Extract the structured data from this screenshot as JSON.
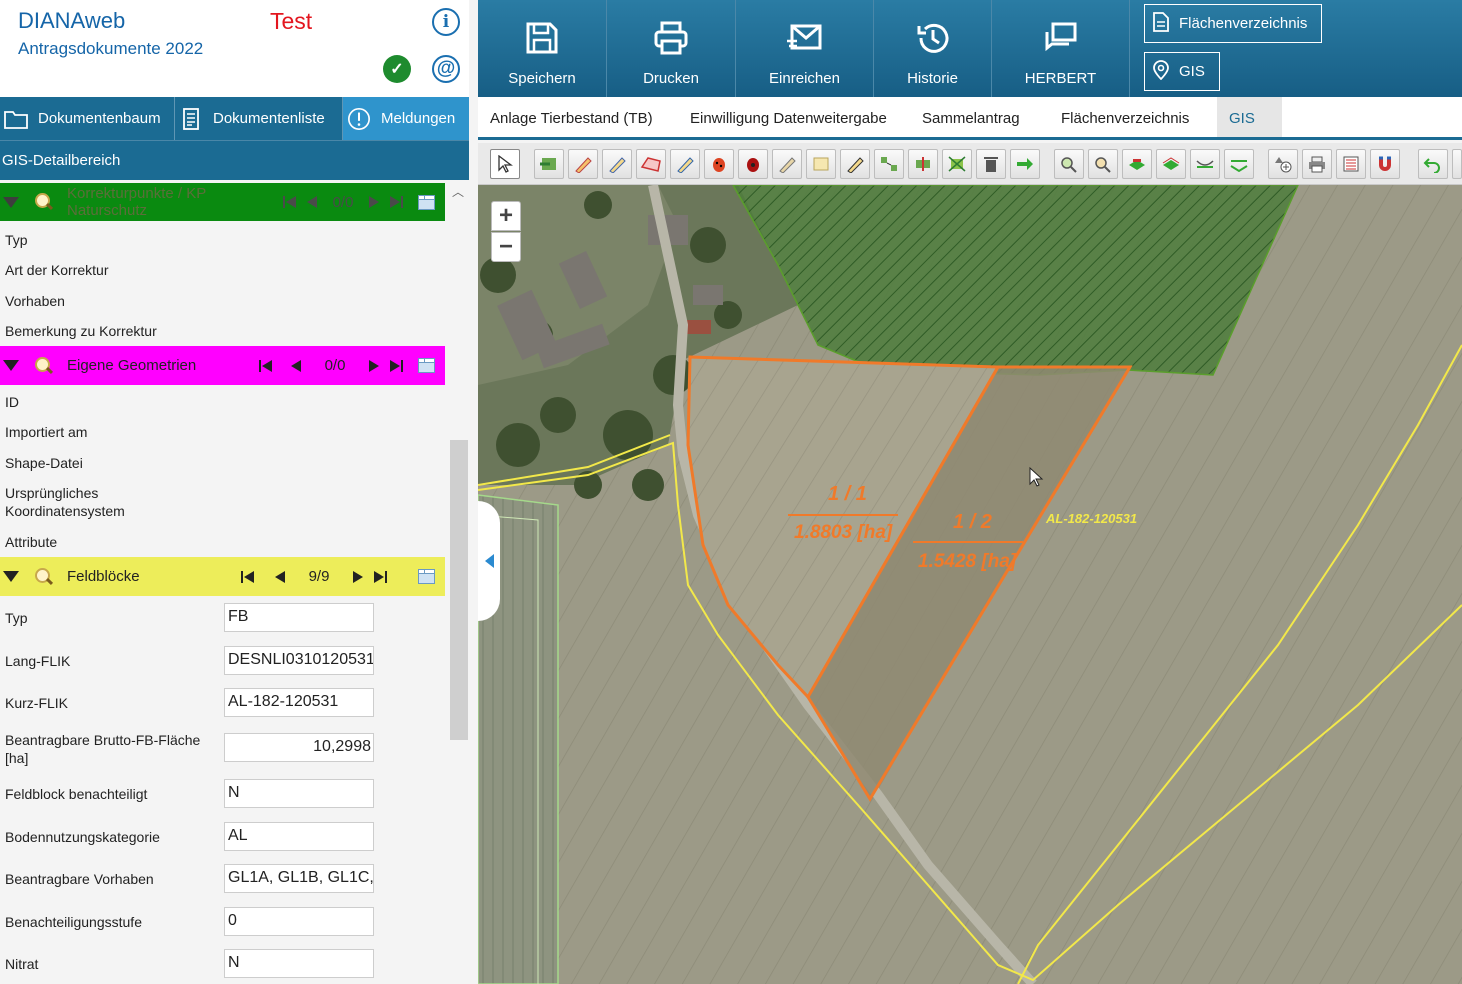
{
  "header": {
    "app_title": "DIANAweb",
    "app_subtitle": "Antragsdokumente 2022",
    "env_label": "Test"
  },
  "left_tabs": [
    {
      "label": "Dokumentenbaum",
      "icon": "folder-icon"
    },
    {
      "label": "Dokumentenliste",
      "icon": "document-list-icon"
    },
    {
      "label": "Meldungen",
      "icon": "exclamation-circle-icon"
    }
  ],
  "gis_detail_title": "GIS-Detailbereich",
  "sections": {
    "korrektur": {
      "title": "Korrekturpunkte / KP Naturschutz",
      "count": "0/0",
      "color": "#0a8a10",
      "fields": [
        "Typ",
        "Art der Korrektur",
        "Vorhaben",
        "Bemerkung zu Korrektur"
      ]
    },
    "eigene": {
      "title": "Eigene Geometrien",
      "count": "0/0",
      "color": "#ff00ff",
      "fields": [
        "ID",
        "Importiert am",
        "Shape-Datei",
        "Ursprüngliches Koordinatensystem",
        "Attribute"
      ]
    },
    "feldbloecke": {
      "title": "Feldblöcke",
      "count": "9/9",
      "color": "#eded5a",
      "fields": [
        {
          "label": "Typ",
          "value": "FB"
        },
        {
          "label": "Lang-FLIK",
          "value": "DESNLI0310120531"
        },
        {
          "label": "Kurz-FLIK",
          "value": "AL-182-120531"
        },
        {
          "label": "Beantragbare Brutto-FB-Fläche [ha]",
          "value": "10,2998"
        },
        {
          "label": "Feldblock benachteiligt",
          "value": "N"
        },
        {
          "label": "Bodennutzungskategorie",
          "value": "AL"
        },
        {
          "label": "Beantragbare Vorhaben",
          "value": "GL1A, GL1B, GL1C,"
        },
        {
          "label": "Benachteiligungsstufe",
          "value": "0"
        },
        {
          "label": "Nitrat",
          "value": "N"
        }
      ]
    }
  },
  "main_toolbar": [
    {
      "label": "Speichern",
      "icon": "save-icon"
    },
    {
      "label": "Drucken",
      "icon": "printer-icon"
    },
    {
      "label": "Einreichen",
      "icon": "send-mail-icon"
    },
    {
      "label": "Historie",
      "icon": "history-icon"
    },
    {
      "label": "HERBERT",
      "icon": "chat-icon"
    }
  ],
  "side_buttons": [
    {
      "label": "Flächenverzeichnis",
      "icon": "document-icon"
    },
    {
      "label": "GIS",
      "icon": "map-pin-icon"
    }
  ],
  "doc_tabs": [
    {
      "label": "Anlage Tierbestand (TB)"
    },
    {
      "label": "Einwilligung Datenweitergabe"
    },
    {
      "label": "Sammelantrag"
    },
    {
      "label": "Flächenverzeichnis"
    },
    {
      "label": "GIS",
      "active": true
    }
  ],
  "map": {
    "zoom_in": "+",
    "zoom_out": "−",
    "parcel_1_id": "1 / 1",
    "parcel_1_area": "1.8803 [ha]",
    "parcel_2_id": "1 / 2",
    "parcel_2_area": "1.5428 [ha]",
    "field_block_label": "AL-182-120531"
  },
  "colors": {
    "brand_blue": "#1b6b93",
    "active_tab": "#2f94cc",
    "parcel_orange": "#f07a2a",
    "fieldblock_yellow": "#f2e84a"
  }
}
